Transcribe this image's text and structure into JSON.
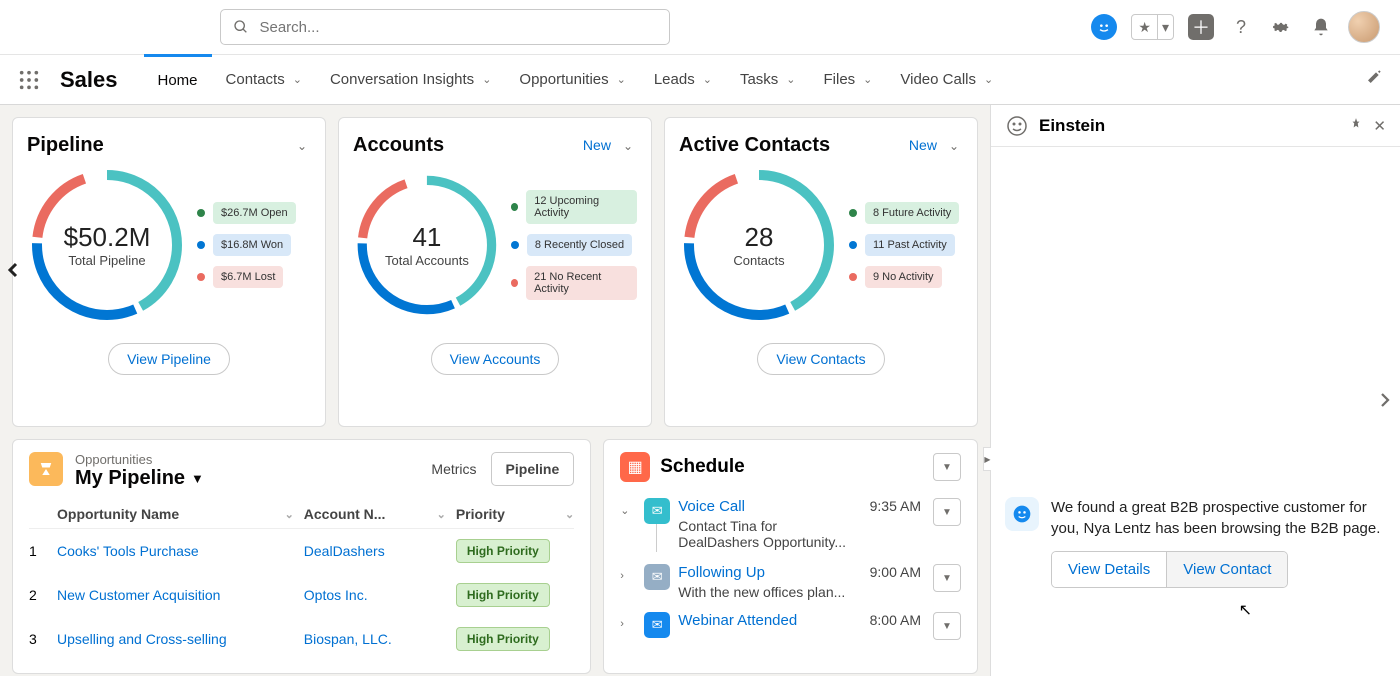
{
  "search": {
    "placeholder": "Search..."
  },
  "appName": "Sales",
  "navTabs": [
    {
      "label": "Home",
      "active": true,
      "dropdown": false
    },
    {
      "label": "Contacts",
      "active": false,
      "dropdown": true
    },
    {
      "label": "Conversation Insights",
      "active": false,
      "dropdown": true
    },
    {
      "label": "Opportunities",
      "active": false,
      "dropdown": true
    },
    {
      "label": "Leads",
      "active": false,
      "dropdown": true
    },
    {
      "label": "Tasks",
      "active": false,
      "dropdown": true
    },
    {
      "label": "Files",
      "active": false,
      "dropdown": true
    },
    {
      "label": "Video Calls",
      "active": false,
      "dropdown": true
    }
  ],
  "cards": {
    "pipeline": {
      "title": "Pipeline",
      "centerValue": "$50.2M",
      "centerLabel": "Total Pipeline",
      "legend": [
        {
          "dot": "#2e844a",
          "text": "$26.7M Open",
          "bg": "#d8f0e0"
        },
        {
          "dot": "#0176d3",
          "text": "$16.8M Won",
          "bg": "#d8e8f8"
        },
        {
          "dot": "#ea6b60",
          "text": "$6.7M Lost",
          "bg": "#f8e0de"
        }
      ],
      "button": "View Pipeline"
    },
    "accounts": {
      "title": "Accounts",
      "newLabel": "New",
      "centerValue": "41",
      "centerLabel": "Total Accounts",
      "legend": [
        {
          "dot": "#2e844a",
          "text": "12 Upcoming Activity",
          "bg": "#d8f0e0"
        },
        {
          "dot": "#0176d3",
          "text": "8 Recently Closed",
          "bg": "#d8e8f8"
        },
        {
          "dot": "#ea6b60",
          "text": "21 No Recent Activity",
          "bg": "#f8e0de"
        }
      ],
      "button": "View Accounts"
    },
    "contacts": {
      "title": "Active Contacts",
      "newLabel": "New",
      "centerValue": "28",
      "centerLabel": "Contacts",
      "legend": [
        {
          "dot": "#2e844a",
          "text": "8 Future Activity",
          "bg": "#d8f0e0"
        },
        {
          "dot": "#0176d3",
          "text": "11 Past Activity",
          "bg": "#d8e8f8"
        },
        {
          "dot": "#ea6b60",
          "text": "9 No Activity",
          "bg": "#f8e0de"
        }
      ],
      "button": "View Contacts"
    }
  },
  "opportunities": {
    "subhead": "Opportunities",
    "title": "My Pipeline",
    "tabs": {
      "metrics": "Metrics",
      "pipeline": "Pipeline"
    },
    "columns": {
      "name": "Opportunity Name",
      "account": "Account N...",
      "priority": "Priority"
    },
    "rows": [
      {
        "num": "1",
        "name": "Cooks' Tools Purchase",
        "account": "DealDashers",
        "priority": "High Priority"
      },
      {
        "num": "2",
        "name": "New Customer Acquisition",
        "account": "Optos Inc.",
        "priority": "High Priority"
      },
      {
        "num": "3",
        "name": "Upselling and Cross-selling",
        "account": "Biospan, LLC.",
        "priority": "High Priority"
      }
    ]
  },
  "schedule": {
    "title": "Schedule",
    "items": [
      {
        "exp": "down",
        "iconBg": "#34becd",
        "link": "Voice Call",
        "time": "9:35 AM",
        "desc": "Contact Tina for DealDashers Opportunity..."
      },
      {
        "exp": "right",
        "iconBg": "#95aec5",
        "link": "Following Up",
        "time": "9:00 AM",
        "desc": "With the new offices plan..."
      },
      {
        "exp": "right",
        "iconBg": "#1589ee",
        "link": "Webinar Attended",
        "time": "8:00 AM",
        "desc": ""
      }
    ]
  },
  "einstein": {
    "title": "Einstein",
    "message": "We found a great B2B prospective customer for you, Nya Lentz has been browsing the B2B page.",
    "buttons": {
      "details": "View Details",
      "contact": "View Contact"
    }
  },
  "chart_data": [
    {
      "type": "pie",
      "title": "Pipeline",
      "total_label": "Total Pipeline",
      "total": 50.2,
      "unit": "$M",
      "series": [
        {
          "name": "Open",
          "value": 26.7
        },
        {
          "name": "Won",
          "value": 16.8
        },
        {
          "name": "Lost",
          "value": 6.7
        }
      ]
    },
    {
      "type": "pie",
      "title": "Accounts",
      "total_label": "Total Accounts",
      "total": 41,
      "series": [
        {
          "name": "Upcoming Activity",
          "value": 12
        },
        {
          "name": "Recently Closed",
          "value": 8
        },
        {
          "name": "No Recent Activity",
          "value": 21
        }
      ]
    },
    {
      "type": "pie",
      "title": "Active Contacts",
      "total_label": "Contacts",
      "total": 28,
      "series": [
        {
          "name": "Future Activity",
          "value": 8
        },
        {
          "name": "Past Activity",
          "value": 11
        },
        {
          "name": "No Activity",
          "value": 9
        }
      ]
    }
  ]
}
